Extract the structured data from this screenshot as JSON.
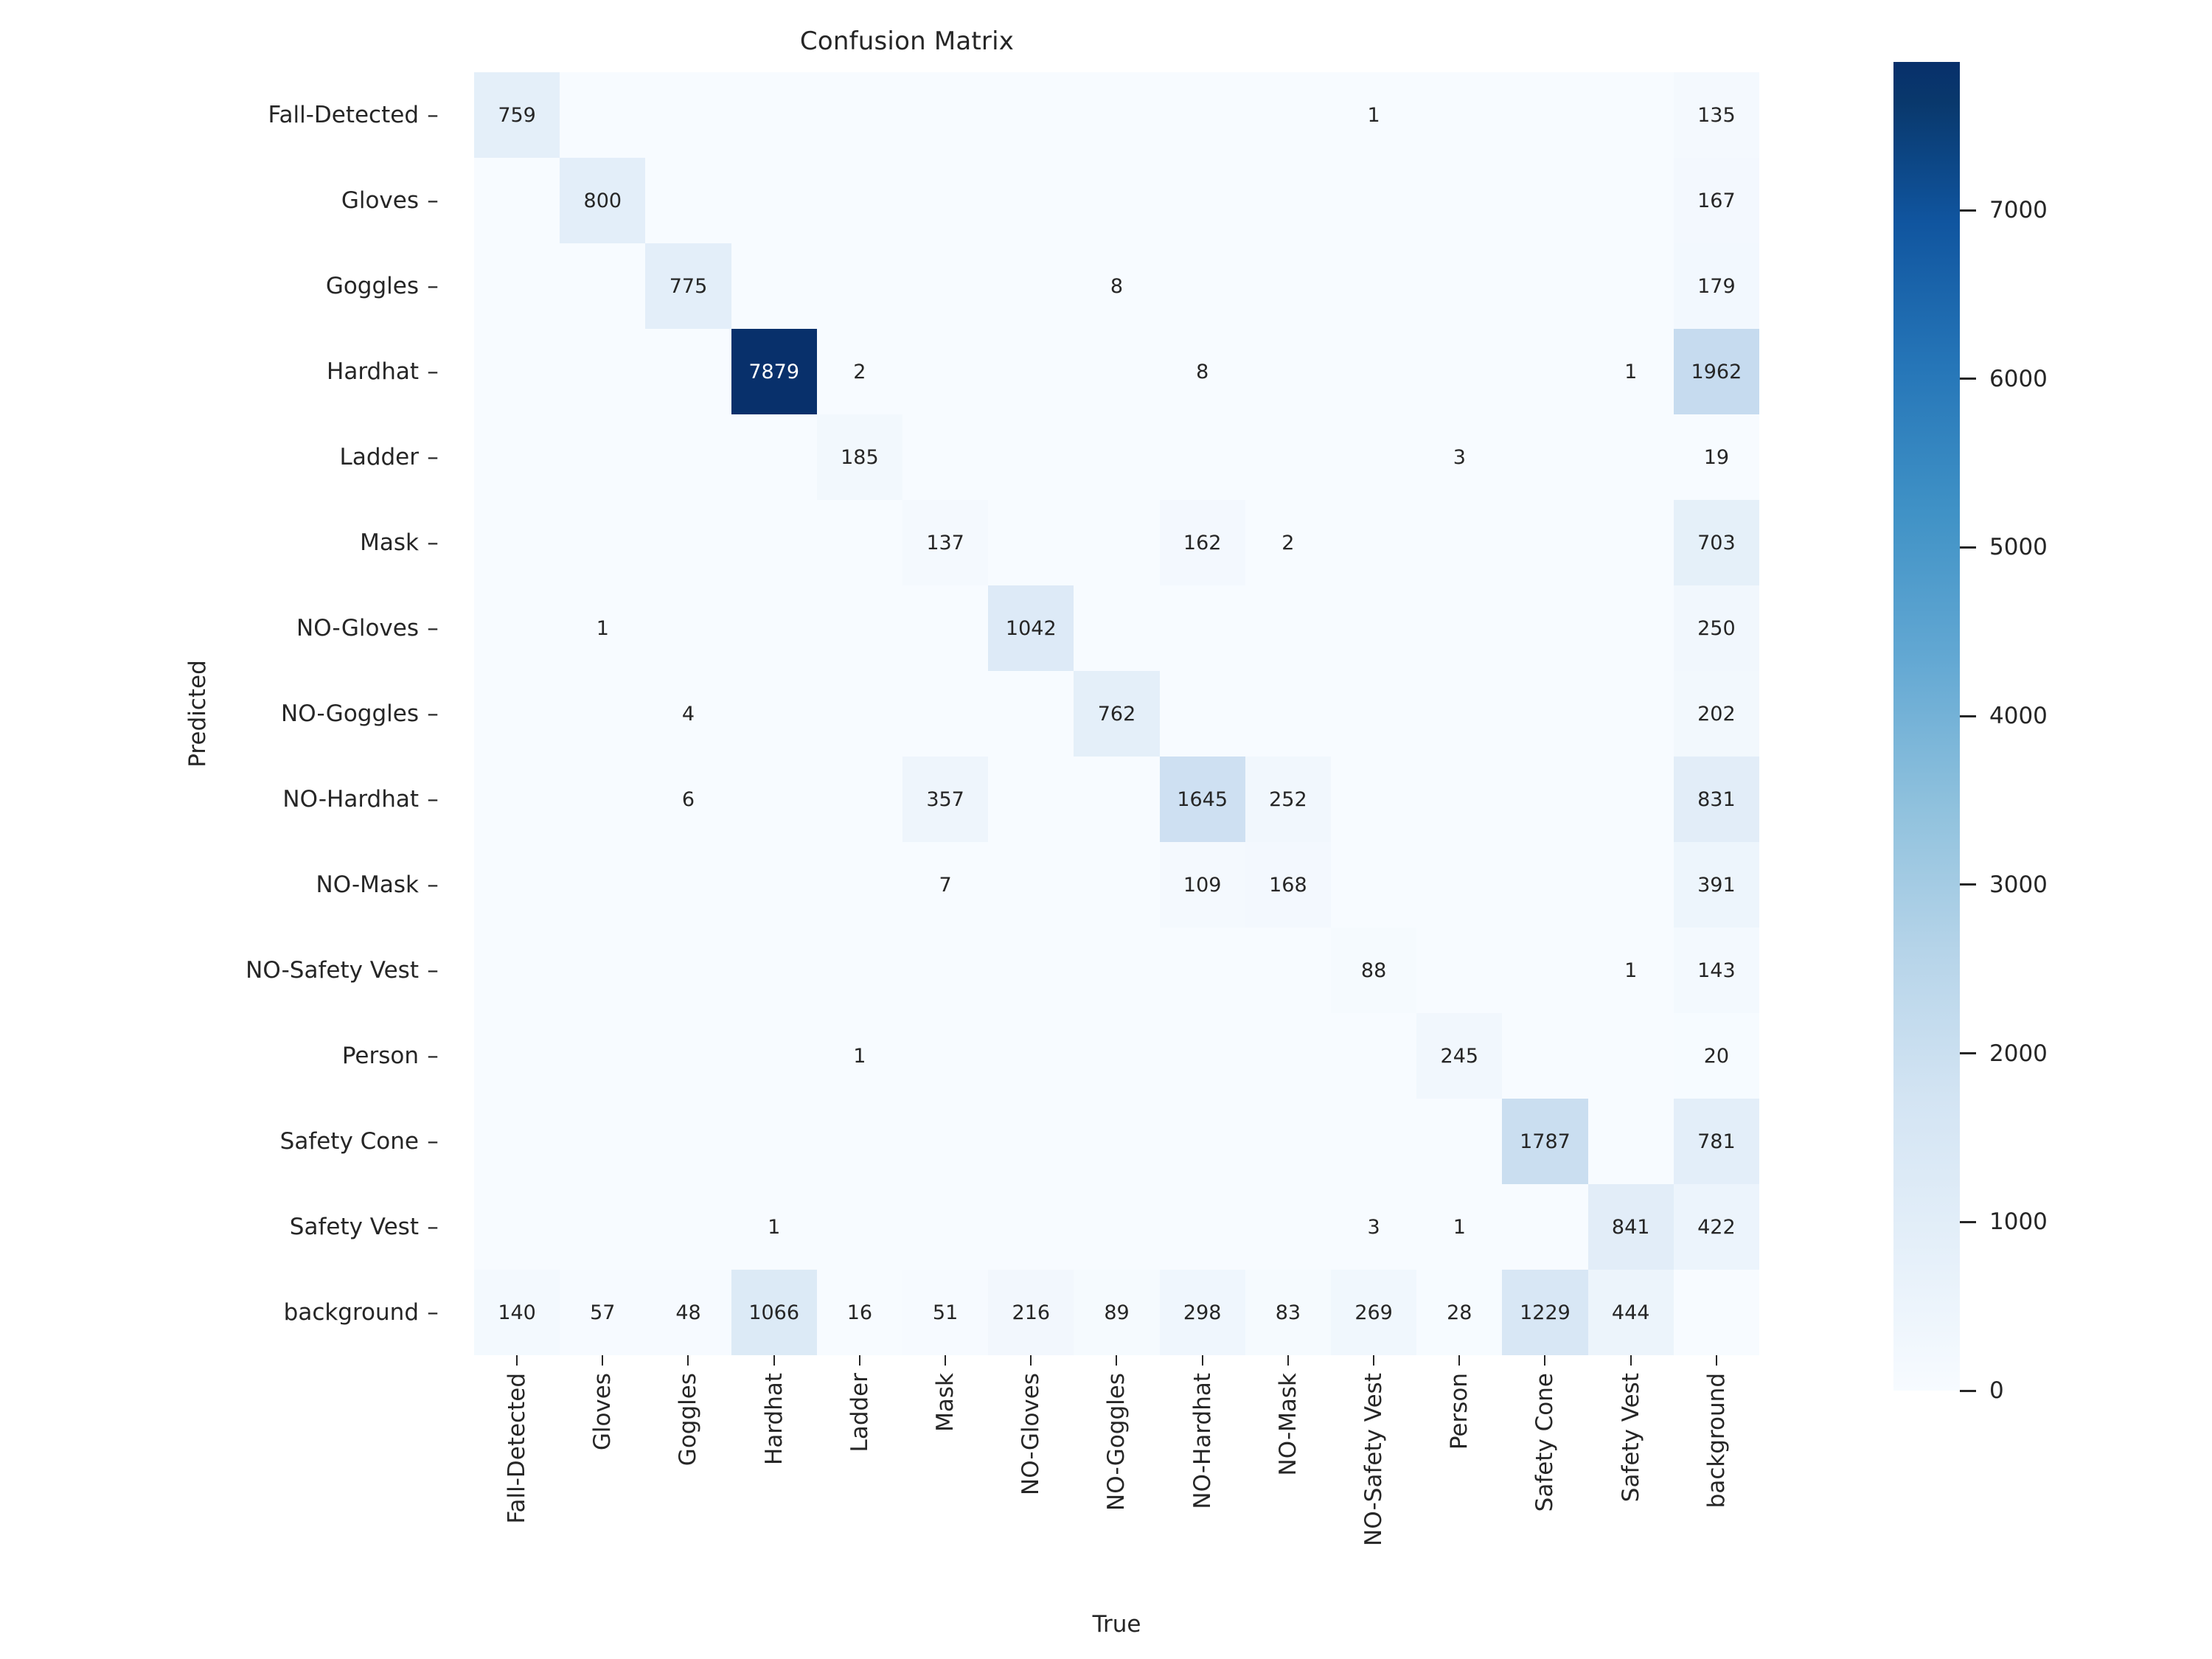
{
  "chart_data": {
    "type": "heatmap",
    "title": "Confusion Matrix",
    "xlabel": "True",
    "ylabel": "Predicted",
    "grid": false,
    "legend_position": "right-colorbar",
    "colormap": "Blues",
    "vmin": 0,
    "vmax": 7879,
    "colorbar_ticks": [
      "0",
      "1000",
      "2000",
      "3000",
      "4000",
      "5000",
      "6000",
      "7000"
    ],
    "colorbar_tick_values": [
      0,
      1000,
      2000,
      3000,
      4000,
      5000,
      6000,
      7000
    ],
    "categories_x": [
      "Fall-Detected",
      "Gloves",
      "Goggles",
      "Hardhat",
      "Ladder",
      "Mask",
      "NO-Gloves",
      "NO-Goggles",
      "NO-Hardhat",
      "NO-Mask",
      "NO-Safety Vest",
      "Person",
      "Safety Cone",
      "Safety Vest",
      "background"
    ],
    "categories_y": [
      "Fall-Detected",
      "Gloves",
      "Goggles",
      "Hardhat",
      "Ladder",
      "Mask",
      "NO-Gloves",
      "NO-Goggles",
      "NO-Hardhat",
      "NO-Mask",
      "NO-Safety Vest",
      "Person",
      "Safety Cone",
      "Safety Vest",
      "background"
    ],
    "rows": [
      {
        "label": "Fall-Detected",
        "values": [
          759,
          null,
          null,
          null,
          null,
          null,
          null,
          null,
          null,
          null,
          1,
          null,
          null,
          null,
          135
        ]
      },
      {
        "label": "Gloves",
        "values": [
          null,
          800,
          null,
          null,
          null,
          null,
          null,
          null,
          null,
          null,
          null,
          null,
          null,
          null,
          167
        ]
      },
      {
        "label": "Goggles",
        "values": [
          null,
          null,
          775,
          null,
          null,
          null,
          null,
          8,
          null,
          null,
          null,
          null,
          null,
          null,
          179
        ]
      },
      {
        "label": "Hardhat",
        "values": [
          null,
          null,
          null,
          7879,
          2,
          null,
          null,
          null,
          8,
          null,
          null,
          null,
          null,
          1,
          1962
        ]
      },
      {
        "label": "Ladder",
        "values": [
          null,
          null,
          null,
          null,
          185,
          null,
          null,
          null,
          null,
          null,
          null,
          3,
          null,
          null,
          19
        ]
      },
      {
        "label": "Mask",
        "values": [
          null,
          null,
          null,
          null,
          null,
          137,
          null,
          null,
          162,
          2,
          null,
          null,
          null,
          null,
          703
        ]
      },
      {
        "label": "NO-Gloves",
        "values": [
          null,
          1,
          null,
          null,
          null,
          null,
          1042,
          null,
          null,
          null,
          null,
          null,
          null,
          null,
          250
        ]
      },
      {
        "label": "NO-Goggles",
        "values": [
          null,
          null,
          4,
          null,
          null,
          null,
          null,
          762,
          null,
          null,
          null,
          null,
          null,
          null,
          202
        ]
      },
      {
        "label": "NO-Hardhat",
        "values": [
          null,
          null,
          6,
          null,
          null,
          357,
          null,
          null,
          1645,
          252,
          null,
          null,
          null,
          null,
          831
        ]
      },
      {
        "label": "NO-Mask",
        "values": [
          null,
          null,
          null,
          null,
          null,
          7,
          null,
          null,
          109,
          168,
          null,
          null,
          null,
          null,
          391
        ]
      },
      {
        "label": "NO-Safety Vest",
        "values": [
          null,
          null,
          null,
          null,
          null,
          null,
          null,
          null,
          null,
          null,
          88,
          null,
          null,
          1,
          143
        ]
      },
      {
        "label": "Person",
        "values": [
          null,
          null,
          null,
          null,
          1,
          null,
          null,
          null,
          null,
          null,
          null,
          245,
          null,
          null,
          20
        ]
      },
      {
        "label": "Safety Cone",
        "values": [
          null,
          null,
          null,
          null,
          null,
          null,
          null,
          null,
          null,
          null,
          null,
          null,
          1787,
          null,
          781
        ]
      },
      {
        "label": "Safety Vest",
        "values": [
          null,
          null,
          null,
          1,
          null,
          null,
          null,
          null,
          null,
          null,
          3,
          1,
          null,
          841,
          422
        ]
      },
      {
        "label": "background",
        "values": [
          140,
          57,
          48,
          1066,
          16,
          51,
          216,
          89,
          298,
          83,
          269,
          28,
          1229,
          444,
          null
        ]
      }
    ]
  }
}
